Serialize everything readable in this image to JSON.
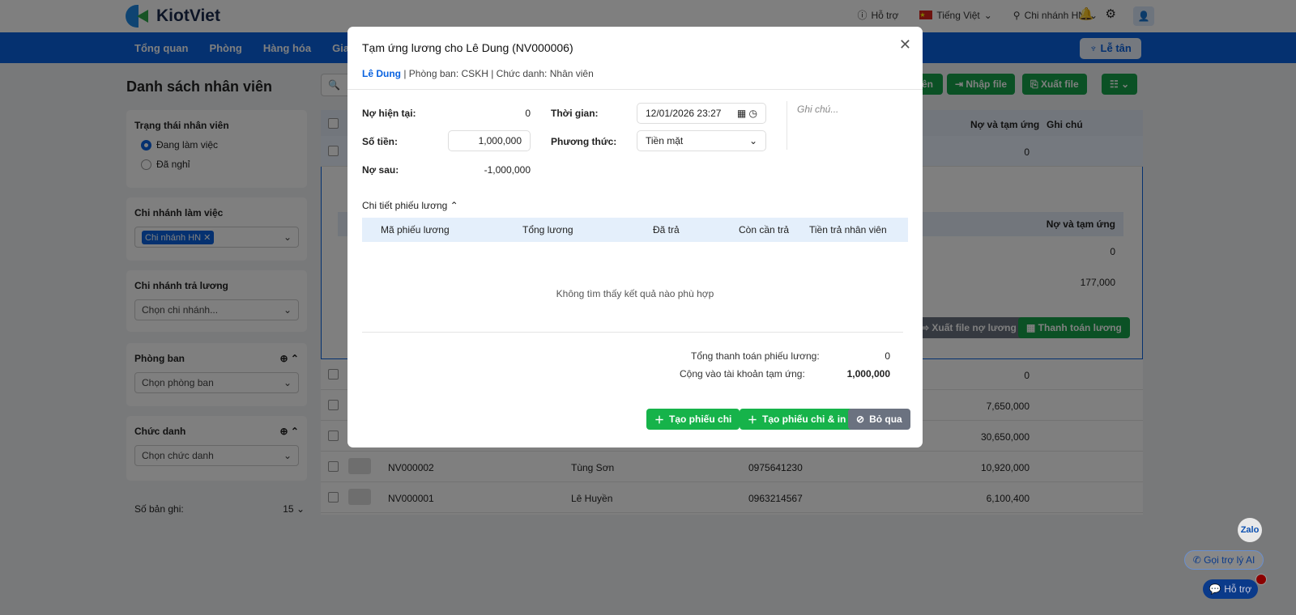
{
  "header": {
    "logo": "KiotViet",
    "support": "Hỗ trợ",
    "language": "Tiếng Việt",
    "branch": "Chi nhánh HN"
  },
  "nav": {
    "items": [
      "Tổng quan",
      "Phòng",
      "Hàng hóa",
      "Giao dịch"
    ],
    "reception": "Lễ tân"
  },
  "page": {
    "title": "Danh sách nhân viên"
  },
  "filters": {
    "status": {
      "title": "Trạng thái nhân viên",
      "options": [
        "Đang làm việc",
        "Đã nghỉ"
      ],
      "selected": "Đang làm việc"
    },
    "work_branch": {
      "title": "Chi nhánh làm việc",
      "tag": "Chi nhánh HN"
    },
    "pay_branch": {
      "title": "Chi nhánh trả lương",
      "placeholder": "Chọn chi nhánh..."
    },
    "department": {
      "title": "Phòng ban",
      "placeholder": "Chọn phòng ban"
    },
    "position": {
      "title": "Chức danh",
      "placeholder": "Chọn chức danh"
    },
    "records": {
      "label": "Số bản ghi:",
      "value": "15"
    }
  },
  "toolbar": {
    "add_partial": "ên",
    "import": "Nhập file",
    "export": "Xuất file"
  },
  "table": {
    "headers": {
      "debt": "Nợ và tạm ứng",
      "note": "Ghi chú"
    },
    "expanded_row_debt": "0",
    "detail": {
      "header_debt": "Nợ và tạm ứng",
      "values": [
        "0",
        "177,000"
      ],
      "export_debt": "Xuất file nợ lương",
      "pay_salary": "Thanh toán lương"
    },
    "rows": [
      {
        "id": "",
        "name": "",
        "phone": "",
        "debt": "0"
      },
      {
        "id": "",
        "name": "",
        "phone": "",
        "debt": "7,650,000"
      },
      {
        "id": "",
        "name": "",
        "phone": "",
        "debt": "30,650,000"
      },
      {
        "id": "NV000002",
        "name": "Tùng Sơn",
        "phone": "0975641230",
        "debt": "10,920,000"
      },
      {
        "id": "NV000001",
        "name": "Lê Huyền",
        "phone": "0963214567",
        "debt": "6,100,400"
      }
    ]
  },
  "modal": {
    "title": "Tạm ứng lương cho Lê Dung (NV000006)",
    "employee": "Lê Dung",
    "department": "Phòng ban: CSKH",
    "position": "Chức danh: Nhân viên",
    "current_debt_label": "Nợ hiện tại:",
    "current_debt": "0",
    "amount_label": "Số tiền:",
    "amount": "1,000,000",
    "after_debt_label": "Nợ sau:",
    "after_debt": "-1,000,000",
    "time_label": "Thời gian:",
    "time": "12/01/2026 23:27",
    "method_label": "Phương thức:",
    "method": "Tiền mặt",
    "note_placeholder": "Ghi chú...",
    "detail_toggle": "Chi tiết phiếu lương",
    "columns": [
      "Mã phiếu lương",
      "Tổng lương",
      "Đã trả",
      "Còn cần trả",
      "Tiền trả nhân viên"
    ],
    "empty": "Không tìm thấy kết quả nào phù hợp",
    "total_paid_label": "Tổng thanh toán phiếu lương:",
    "total_paid": "0",
    "advance_label": "Cộng vào tài khoản tạm ứng:",
    "advance": "1,000,000",
    "btn_create": "Tạo phiếu chi",
    "btn_create_print": "Tạo phiếu chi & in",
    "btn_cancel": "Bỏ qua"
  },
  "widgets": {
    "zalo": "Zalo",
    "ai": "Gọi trợ lý AI",
    "support": "Hỗ trợ"
  },
  "colors": {
    "primary": "#0a63e0",
    "success": "#16a34a",
    "muted": "#6b7280"
  }
}
